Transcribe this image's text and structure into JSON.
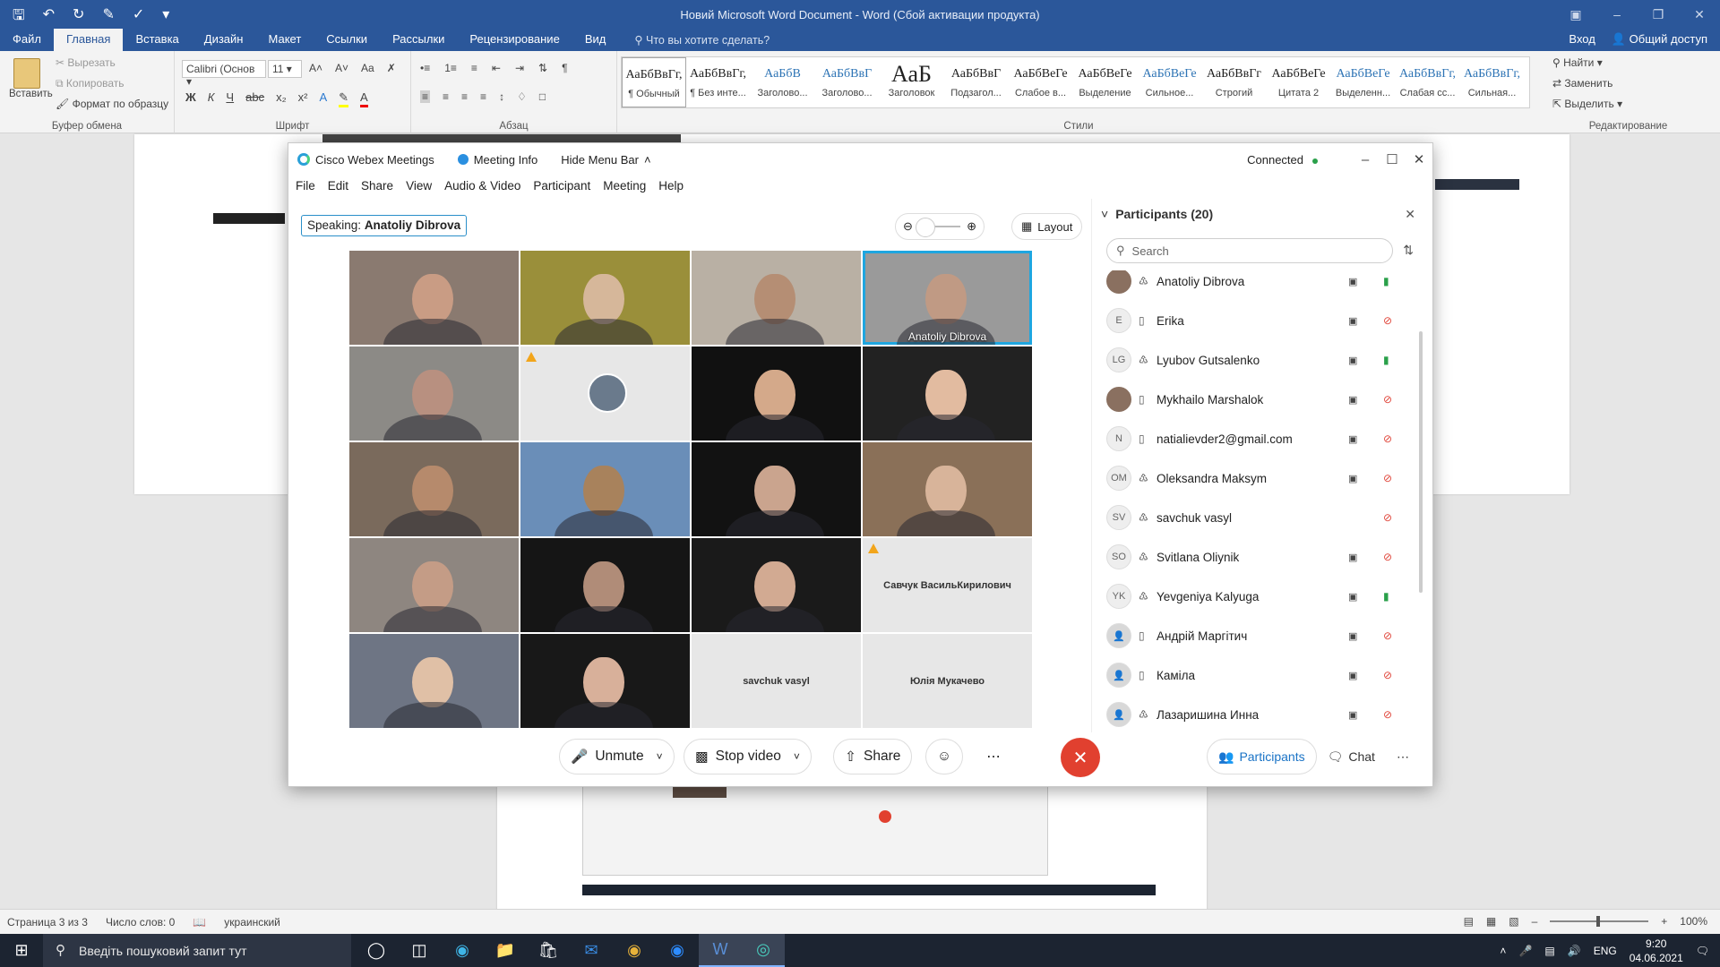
{
  "word": {
    "title": "Новий Microsoft Word Document - Word (Сбой активации продукта)",
    "tabs": [
      "Файл",
      "Главная",
      "Вставка",
      "Дизайн",
      "Макет",
      "Ссылки",
      "Рассылки",
      "Рецензирование",
      "Вид"
    ],
    "active_tab": "Главная",
    "tell_me": "Что вы хотите сделать?",
    "signin": "Вход",
    "share": "Общий доступ",
    "clipboard": {
      "paste": "Вставить",
      "cut": "Вырезать",
      "copy": "Копировать",
      "format_painter": "Формат по образцу",
      "label": "Буфер обмена"
    },
    "font": {
      "name": "Calibri (Основ",
      "size": "11",
      "label": "Шрифт"
    },
    "paragraph_label": "Абзац",
    "styles": [
      {
        "preview": "АаБбВвГг,",
        "name": "¶ Обычный"
      },
      {
        "preview": "АаБбВвГг,",
        "name": "¶ Без инте..."
      },
      {
        "preview": "АаБбВ",
        "name": "Заголово..."
      },
      {
        "preview": "АаБбВвГ",
        "name": "Заголово..."
      },
      {
        "preview": "АаБ",
        "name": "Заголовок"
      },
      {
        "preview": "АаБбВвГ",
        "name": "Подзагол..."
      },
      {
        "preview": "АаБбВеГе",
        "name": "Слабое в..."
      },
      {
        "preview": "АаБбВеГе",
        "name": "Выделение"
      },
      {
        "preview": "АаБбВеГе",
        "name": "Сильное..."
      },
      {
        "preview": "АаБбВвГг",
        "name": "Строгий"
      },
      {
        "preview": "АаБбВеГе",
        "name": "Цитата 2"
      },
      {
        "preview": "АаБбВеГе",
        "name": "Выделенн..."
      },
      {
        "preview": "АаБбВвГг,",
        "name": "Слабая сс..."
      },
      {
        "preview": "АаБбВвГг,",
        "name": "Сильная..."
      }
    ],
    "styles_label": "Стили",
    "editing": {
      "find": "Найти",
      "replace": "Заменить",
      "select": "Выделить",
      "label": "Редактирование"
    },
    "status": {
      "page": "Страница 3 из 3",
      "words": "Число слов: 0",
      "language": "украинский",
      "zoom": "100%"
    }
  },
  "webex": {
    "app_name": "Cisco Webex Meetings",
    "meeting_info": "Meeting Info",
    "hide_menu": "Hide Menu Bar",
    "connected": "Connected",
    "menu": [
      "File",
      "Edit",
      "Share",
      "View",
      "Audio & Video",
      "Participant",
      "Meeting",
      "Help"
    ],
    "speaking_label": "Speaking:",
    "speaking_name": "Anatoliy Dibrova",
    "layout": "Layout",
    "tiles": [
      {
        "bg": "#8a7a70",
        "face": "#c99c84",
        "name": ""
      },
      {
        "bg": "#9a8f3a",
        "face": "#d6b79a",
        "name": ""
      },
      {
        "bg": "#b9b0a4",
        "face": "#b58e74",
        "name": ""
      },
      {
        "bg": "#9a9a9a",
        "face": "#c09a84",
        "name": "Anatoliy Dibrova",
        "active": true
      },
      {
        "bg": "#8c8a86",
        "face": "#b89080",
        "name": ""
      },
      {
        "bg": "#e7e7e7",
        "face": "",
        "name": "",
        "avatar": true,
        "warn": true
      },
      {
        "bg": "#111111",
        "face": "#d4a98a",
        "name": ""
      },
      {
        "bg": "#222222",
        "face": "#e2bba0",
        "name": ""
      },
      {
        "bg": "#7a6a5c",
        "face": "#b68a6c",
        "name": ""
      },
      {
        "bg": "#6a8eb8",
        "face": "#a8825c",
        "name": ""
      },
      {
        "bg": "#121212",
        "face": "#caa48e",
        "name": ""
      },
      {
        "bg": "#8a7058",
        "face": "#d8b49a",
        "name": ""
      },
      {
        "bg": "#8e8680",
        "face": "#c49c86",
        "name": ""
      },
      {
        "bg": "#151515",
        "face": "#b08c78",
        "name": ""
      },
      {
        "bg": "#1a1a1a",
        "face": "#d2aa92",
        "name": ""
      },
      {
        "bg": "#e7e7e7",
        "face": "",
        "name": "Савчук ВасильКирилович",
        "placeholder": true,
        "warn": true
      },
      {
        "bg": "#6e7584",
        "face": "#e0c0a6",
        "name": ""
      },
      {
        "bg": "#181818",
        "face": "#d8b09a",
        "name": ""
      },
      {
        "bg": "#e7e7e7",
        "face": "",
        "name": "savchuk vasyl",
        "placeholder": true
      },
      {
        "bg": "#e7e7e7",
        "face": "",
        "name": "Юлія Мукачево",
        "placeholder": true
      }
    ],
    "participants": {
      "title": "Participants (20)",
      "search_placeholder": "Search",
      "list": [
        {
          "initials": "",
          "name": "Anatoliy Dibrova",
          "device": "audio",
          "cam": true,
          "mic": "on",
          "photo": true
        },
        {
          "initials": "E",
          "name": "Erika",
          "device": "phone",
          "cam": true,
          "mic": "off"
        },
        {
          "initials": "LG",
          "name": "Lyubov Gutsalenko",
          "device": "audio",
          "cam": true,
          "mic": "on"
        },
        {
          "initials": "",
          "name": "Mykhailo Marshalok",
          "device": "phone",
          "cam": true,
          "mic": "off",
          "photo": true
        },
        {
          "initials": "N",
          "name": "natialievder2@gmail.com",
          "device": "phone",
          "cam": true,
          "mic": "off"
        },
        {
          "initials": "OM",
          "name": "Oleksandra Maksym",
          "device": "audio",
          "cam": true,
          "mic": "off"
        },
        {
          "initials": "SV",
          "name": "savchuk vasyl",
          "device": "audio",
          "cam": false,
          "mic": "off"
        },
        {
          "initials": "SO",
          "name": "Svitlana Oliynik",
          "device": "audio",
          "cam": true,
          "mic": "off"
        },
        {
          "initials": "YK",
          "name": "Yevgeniya Kalyuga",
          "device": "audio",
          "cam": true,
          "mic": "on"
        },
        {
          "initials": "",
          "name": "Андрій Маргітич",
          "device": "phone",
          "cam": true,
          "mic": "off",
          "generic": true
        },
        {
          "initials": "",
          "name": "Каміла",
          "device": "phone",
          "cam": true,
          "mic": "off",
          "generic": true
        },
        {
          "initials": "",
          "name": "Лазаришина Инна",
          "device": "audio",
          "cam": true,
          "mic": "off",
          "generic": true
        }
      ]
    },
    "controls": {
      "unmute": "Unmute",
      "stop_video": "Stop video",
      "share": "Share",
      "participants": "Participants",
      "chat": "Chat"
    }
  },
  "taskbar": {
    "search_placeholder": "Введіть пошуковий запит тут",
    "lang": "ENG",
    "time": "9:20",
    "date": "04.06.2021"
  },
  "colors": {
    "word_blue": "#2b579a",
    "webex_accent": "#1ea6e0",
    "end_red": "#e1402f",
    "mic_on": "#2aa04a",
    "mic_off": "#e0463b"
  }
}
